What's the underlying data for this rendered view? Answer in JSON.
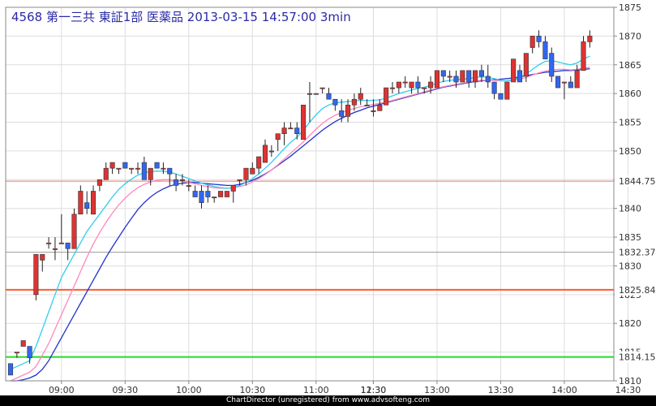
{
  "chart_data": {
    "type": "candlestick",
    "title": "4568 第一三共 東証1部 医薬品 2013-03-15 14:57:00 3min",
    "footer": "ChartDirector (unregistered) from www.advsofteng.com",
    "ylim": [
      1810,
      1875
    ],
    "y_ticks": [
      1810,
      1815,
      1820,
      1825,
      1830,
      1835,
      1840,
      1845,
      1850,
      1855,
      1860,
      1865,
      1870,
      1875
    ],
    "y_tick_labels": [
      "1810",
      "1815",
      "1820",
      "1825",
      "1830",
      "1835",
      "1840",
      "1845",
      "1850",
      "1855",
      "1860",
      "1865",
      "1870",
      "1875"
    ],
    "x_ticks": [
      {
        "i": 8,
        "label": "09:00"
      },
      {
        "i": 18,
        "label": "09:30"
      },
      {
        "i": 28,
        "label": "10:00"
      },
      {
        "i": 38,
        "label": "10:30"
      },
      {
        "i": 48,
        "label": "11:00"
      },
      {
        "i": 57,
        "label": "11:30"
      },
      {
        "i": 57,
        "label": "12:30"
      },
      {
        "i": 67,
        "label": "13:00"
      },
      {
        "i": 77,
        "label": "13:30"
      },
      {
        "i": 87,
        "label": "14:00"
      },
      {
        "i": 97,
        "label": "14:30"
      }
    ],
    "hlines": [
      {
        "value": 1844.75,
        "label": "1844.75",
        "color": "#e07a6a",
        "width": 1
      },
      {
        "value": 1832.375,
        "label": "1832.375",
        "color": "#999999",
        "width": 1
      },
      {
        "value": 1825.841,
        "label": "1825.841",
        "color": "#ff5a2a",
        "width": 2
      },
      {
        "value": 1814.159,
        "label": "1814.159",
        "color": "#22dd22",
        "width": 2
      }
    ],
    "colors": {
      "up": "#dd3333",
      "down": "#3366ee",
      "ma_short": "#33ccee",
      "ma_mid": "#ff88bb",
      "ma_long": "#2233cc",
      "grid": "#dddddd"
    },
    "candles": [
      [
        1813,
        1813,
        1811,
        1811
      ],
      [
        1815,
        1815,
        1814,
        1815
      ],
      [
        1816,
        1817,
        1816,
        1817
      ],
      [
        1816,
        1816,
        1813,
        1814
      ],
      [
        1825,
        1832,
        1824,
        1832
      ],
      [
        1831,
        1832,
        1829,
        1832
      ],
      [
        1834,
        1835,
        1833,
        1834
      ],
      [
        1833,
        1835,
        1831,
        1833
      ],
      [
        1834,
        1839,
        1834,
        1834
      ],
      [
        1834,
        1834,
        1831,
        1833
      ],
      [
        1833,
        1840,
        1833,
        1839
      ],
      [
        1839,
        1844,
        1839,
        1843
      ],
      [
        1841,
        1843,
        1839,
        1840
      ],
      [
        1839,
        1844,
        1839,
        1843
      ],
      [
        1844,
        1845,
        1843,
        1845
      ],
      [
        1845,
        1848,
        1845,
        1847
      ],
      [
        1847,
        1848,
        1846,
        1848
      ],
      [
        1847,
        1847,
        1846,
        1847
      ],
      [
        1848,
        1848,
        1847,
        1847
      ],
      [
        1847,
        1847,
        1846,
        1847
      ],
      [
        1847,
        1848,
        1846,
        1847
      ],
      [
        1848,
        1849,
        1845,
        1845
      ],
      [
        1845,
        1847,
        1844,
        1847
      ],
      [
        1848,
        1848,
        1847,
        1847
      ],
      [
        1847,
        1848,
        1846,
        1847
      ],
      [
        1847,
        1847,
        1844,
        1846
      ],
      [
        1845,
        1846,
        1843,
        1844
      ],
      [
        1845,
        1846,
        1844,
        1845
      ],
      [
        1844,
        1845,
        1843,
        1844
      ],
      [
        1843,
        1844,
        1842,
        1842
      ],
      [
        1843,
        1844,
        1840,
        1841
      ],
      [
        1843,
        1844,
        1841,
        1842
      ],
      [
        1842,
        1842,
        1841,
        1842
      ],
      [
        1842,
        1843,
        1842,
        1843
      ],
      [
        1842,
        1843,
        1842,
        1843
      ],
      [
        1843,
        1844,
        1841,
        1844
      ],
      [
        1845,
        1845,
        1844,
        1845
      ],
      [
        1845,
        1847,
        1844,
        1847
      ],
      [
        1846,
        1848,
        1846,
        1847
      ],
      [
        1847,
        1849,
        1846,
        1849
      ],
      [
        1848,
        1852,
        1848,
        1851
      ],
      [
        1850,
        1851,
        1849,
        1850
      ],
      [
        1852,
        1853,
        1850,
        1853
      ],
      [
        1853,
        1855,
        1851,
        1854
      ],
      [
        1854,
        1855,
        1854,
        1854
      ],
      [
        1854,
        1855,
        1852,
        1853
      ],
      [
        1852,
        1858,
        1852,
        1858
      ],
      [
        1860,
        1862,
        1855,
        1860
      ],
      [
        1860,
        1860,
        1860,
        1860
      ],
      [
        1861,
        1861,
        1860,
        1861
      ],
      [
        1860,
        1861,
        1859,
        1859
      ],
      [
        1859,
        1859,
        1857,
        1858
      ],
      [
        1857,
        1859,
        1855,
        1856
      ],
      [
        1856,
        1859,
        1855,
        1858
      ],
      [
        1858,
        1860,
        1857,
        1859
      ],
      [
        1859,
        1861,
        1858,
        1860
      ],
      [
        1858,
        1859,
        1858,
        1858
      ],
      [
        1857,
        1859,
        1856,
        1857
      ],
      [
        1857,
        1859,
        1857,
        1858
      ],
      [
        1858,
        1861,
        1858,
        1861
      ],
      [
        1861,
        1862,
        1860,
        1861
      ],
      [
        1861,
        1862,
        1860,
        1862
      ],
      [
        1862,
        1863,
        1861,
        1862
      ],
      [
        1861,
        1862,
        1860,
        1862
      ],
      [
        1862,
        1863,
        1860,
        1861
      ],
      [
        1861,
        1861,
        1860,
        1861
      ],
      [
        1861,
        1863,
        1860,
        1862
      ],
      [
        1861,
        1864,
        1861,
        1864
      ],
      [
        1864,
        1864,
        1862,
        1863
      ],
      [
        1863,
        1864,
        1862,
        1863
      ],
      [
        1863,
        1864,
        1861,
        1862
      ],
      [
        1862,
        1864,
        1862,
        1864
      ],
      [
        1864,
        1864,
        1861,
        1862
      ],
      [
        1862,
        1864,
        1861,
        1864
      ],
      [
        1864,
        1865,
        1862,
        1863
      ],
      [
        1863,
        1865,
        1861,
        1862
      ],
      [
        1862,
        1862,
        1859,
        1860
      ],
      [
        1860,
        1860,
        1859,
        1859
      ],
      [
        1859,
        1862,
        1859,
        1862
      ],
      [
        1862,
        1866,
        1862,
        1866
      ],
      [
        1864,
        1865,
        1862,
        1862
      ],
      [
        1863,
        1867,
        1862,
        1867
      ],
      [
        1868,
        1870,
        1867,
        1870
      ],
      [
        1870,
        1871,
        1868,
        1869
      ],
      [
        1869,
        1870,
        1866,
        1866
      ],
      [
        1867,
        1868,
        1862,
        1863
      ],
      [
        1863,
        1863,
        1861,
        1861
      ],
      [
        1862,
        1862,
        1859,
        1862
      ],
      [
        1862,
        1863,
        1861,
        1861
      ],
      [
        1861,
        1865,
        1861,
        1864
      ],
      [
        1864,
        1870,
        1864,
        1869
      ],
      [
        1869,
        1871,
        1868,
        1870
      ]
    ],
    "ma_short": [
      1812,
      1812.5,
      1813,
      1813.5,
      1816,
      1819,
      1822,
      1825,
      1828,
      1830,
      1832,
      1834,
      1836,
      1837.5,
      1839,
      1840.5,
      1842,
      1843.3,
      1844.3,
      1845.1,
      1845.8,
      1846.2,
      1846.4,
      1846.5,
      1846.5,
      1846.3,
      1846,
      1845.6,
      1845.2,
      1844.8,
      1844.4,
      1844.1,
      1843.8,
      1843.6,
      1843.5,
      1843.6,
      1844,
      1844.5,
      1845.2,
      1846,
      1847,
      1848,
      1849.2,
      1850.4,
      1851.5,
      1852.4,
      1853.6,
      1855,
      1856.3,
      1857.4,
      1858,
      1858.4,
      1858.5,
      1858.6,
      1858.7,
      1858.8,
      1858.8,
      1858.8,
      1858.9,
      1859.2,
      1859.6,
      1860,
      1860.3,
      1860.6,
      1860.9,
      1861.1,
      1861.4,
      1861.8,
      1862.1,
      1862.3,
      1862.4,
      1862.5,
      1862.6,
      1862.8,
      1862.9,
      1862.8,
      1862.6,
      1862.3,
      1862.2,
      1862.4,
      1862.8,
      1863.4,
      1864.2,
      1865,
      1865.6,
      1865.7,
      1865.5,
      1865.2,
      1865,
      1865.3,
      1866,
      1866.5
    ],
    "ma_mid": [
      1810,
      1810.5,
      1811,
      1811.5,
      1812.5,
      1814.5,
      1816.5,
      1819,
      1821.5,
      1824,
      1826.5,
      1829,
      1831.5,
      1833.8,
      1835.8,
      1837.6,
      1839.2,
      1840.6,
      1841.8,
      1842.8,
      1843.6,
      1844.2,
      1844.6,
      1844.9,
      1845,
      1845,
      1844.9,
      1844.7,
      1844.5,
      1844.3,
      1844,
      1843.8,
      1843.6,
      1843.5,
      1843.5,
      1843.6,
      1843.8,
      1844.1,
      1844.6,
      1845.2,
      1845.9,
      1846.7,
      1847.6,
      1848.6,
      1849.6,
      1850.6,
      1851.6,
      1852.7,
      1853.8,
      1854.8,
      1855.6,
      1856.2,
      1856.7,
      1857.1,
      1857.4,
      1857.7,
      1857.9,
      1858.1,
      1858.3,
      1858.5,
      1858.8,
      1859.1,
      1859.4,
      1859.7,
      1860,
      1860.3,
      1860.6,
      1860.9,
      1861.2,
      1861.4,
      1861.6,
      1861.8,
      1862,
      1862.2,
      1862.3,
      1862.3,
      1862.3,
      1862.2,
      1862.2,
      1862.3,
      1862.5,
      1862.8,
      1863.2,
      1863.6,
      1863.9,
      1864.1,
      1864.2,
      1864.2,
      1864.1,
      1864.2,
      1864.4,
      1864.6
    ],
    "ma_long": [
      1810,
      1810,
      1810.2,
      1810.5,
      1811,
      1812,
      1813.5,
      1815.5,
      1817.5,
      1819.5,
      1821.5,
      1823.5,
      1825.5,
      1827.5,
      1829.5,
      1831.5,
      1833.3,
      1835,
      1836.7,
      1838.3,
      1839.8,
      1841,
      1842,
      1842.8,
      1843.4,
      1843.9,
      1844.2,
      1844.4,
      1844.5,
      1844.5,
      1844.4,
      1844.3,
      1844.2,
      1844.1,
      1844,
      1844,
      1844.2,
      1844.5,
      1844.9,
      1845.4,
      1846,
      1846.7,
      1847.5,
      1848.3,
      1849.1,
      1850,
      1850.9,
      1851.8,
      1852.7,
      1853.6,
      1854.4,
      1855.1,
      1855.7,
      1856.2,
      1856.7,
      1857.1,
      1857.5,
      1857.8,
      1858.1,
      1858.4,
      1858.7,
      1859,
      1859.3,
      1859.6,
      1859.9,
      1860.2,
      1860.5,
      1860.8,
      1861.1,
      1861.3,
      1861.5,
      1861.7,
      1861.9,
      1862.1,
      1862.2,
      1862.3,
      1862.4,
      1862.5,
      1862.6,
      1862.7,
      1862.9,
      1863.1,
      1863.3,
      1863.5,
      1863.7,
      1863.8,
      1863.9,
      1864,
      1864,
      1864.1,
      1864.2,
      1864.3
    ]
  }
}
